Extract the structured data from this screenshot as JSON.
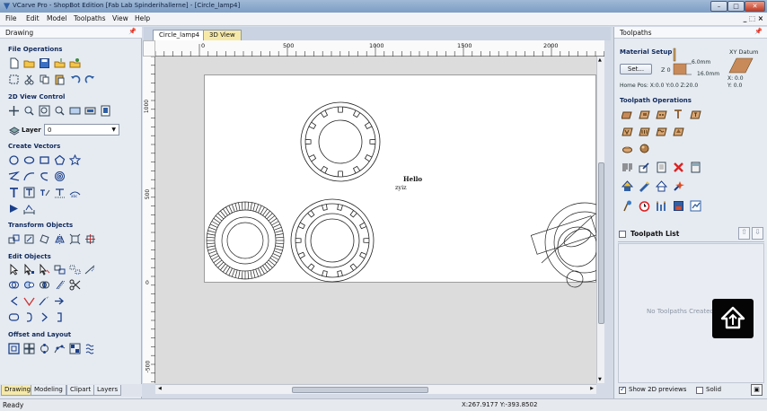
{
  "window": {
    "title": "VCarve Pro - ShopBot Edition [Fab Lab Spinderihallerne] - [Circle_lamp4]"
  },
  "menu": [
    "File",
    "Edit",
    "Model",
    "Toolpaths",
    "View",
    "Help"
  ],
  "mdi_controls": "_ ⬚ ×",
  "left_panel": {
    "title": "Drawing",
    "sections": {
      "file_ops": "File Operations",
      "view_control": "2D View Control",
      "create_vectors": "Create Vectors",
      "transform": "Transform Objects",
      "edit": "Edit Objects",
      "offset": "Offset and Layout"
    },
    "layer_label": "Layer",
    "layer_value": "0",
    "tabs": [
      "Drawing",
      "Modeling",
      "Clipart",
      "Layers"
    ]
  },
  "document": {
    "tabs": [
      "Circle_lamp4",
      "3D View"
    ],
    "ruler_top": [
      "0",
      "500",
      "1000",
      "1500",
      "2000"
    ],
    "ruler_left": [
      "1000",
      "500",
      "0",
      "-500"
    ],
    "canvas_text": [
      "Hello",
      "zyiz"
    ]
  },
  "right_panel": {
    "title": "Toolpaths",
    "material_setup": "Material Setup",
    "set_button": "Set...",
    "z_label": "Z 0",
    "dims": [
      "6.0mm",
      "16.0mm"
    ],
    "home_pos": "Home Pos:  X:0.0 Y:0.0 Z:20.0",
    "xy_datum": "XY Datum",
    "datum_vals": [
      "X: 0.0",
      "Y: 0.0"
    ],
    "toolpath_ops": "Toolpath Operations",
    "toolpath_list": "Toolpath List",
    "empty_msg": "No Toolpaths Created",
    "show_previews": "Show 2D previews",
    "solid": "Solid"
  },
  "status": {
    "ready": "Ready",
    "coords": "X:267.9177 Y:-393.8502"
  },
  "colors": {
    "accent": "#1a3f8a",
    "sheet": "#ffffff",
    "tab_active": "#f6e9a8"
  }
}
